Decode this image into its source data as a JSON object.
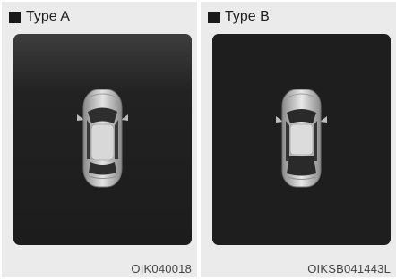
{
  "panels": [
    {
      "label": "Type A",
      "image_code": "OIK040018"
    },
    {
      "label": "Type B",
      "image_code": "OIKSB041443L"
    }
  ],
  "icons": {
    "square": "square-bullet-icon",
    "car": "car-top-view-icon"
  }
}
